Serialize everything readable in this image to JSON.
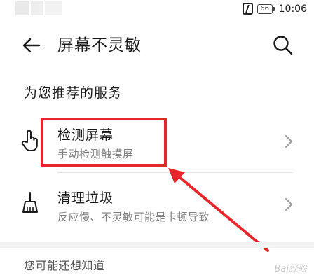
{
  "status_bar": {
    "time": "10:06",
    "battery": "66"
  },
  "header": {
    "title": "屏幕不灵敏"
  },
  "section": {
    "title": "为您推荐的服务"
  },
  "items": [
    {
      "title": "检测屏幕",
      "subtitle": "手动检测触摸屏"
    },
    {
      "title": "清理垃圾",
      "subtitle": "反应慢、不灵敏可能是卡顿导致"
    }
  ],
  "footer": {
    "text": "您可能还想知道"
  },
  "watermark": {
    "text": "Bai经验"
  },
  "annotation": {
    "color": "#e6262b"
  }
}
